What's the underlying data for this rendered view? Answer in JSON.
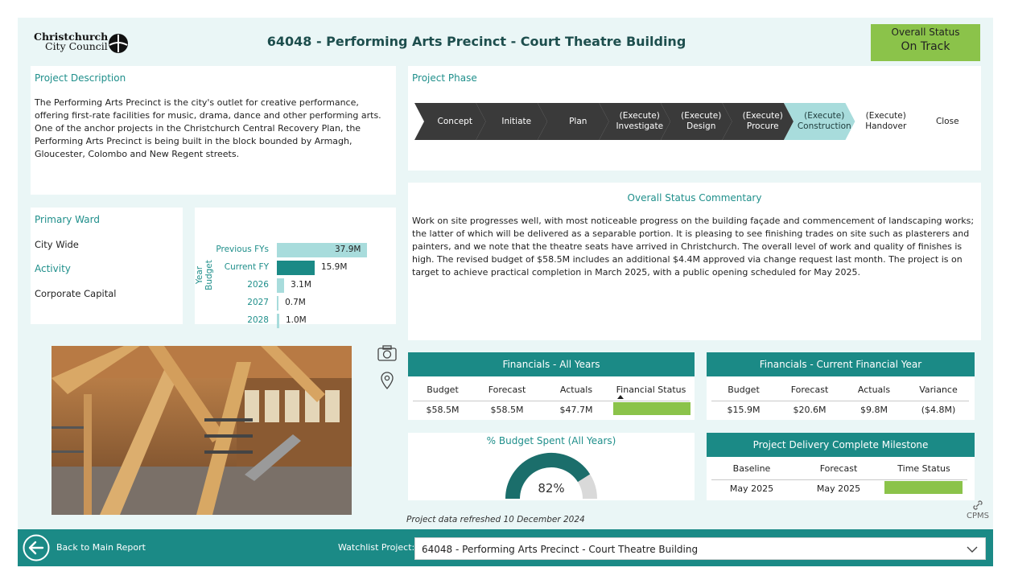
{
  "header": {
    "logo_line1": "Christchurch",
    "logo_line2": "City Council",
    "title": "64048 - Performing Arts Precinct - Court Theatre Building",
    "overall_status_label": "Overall Status",
    "overall_status_value": "On Track"
  },
  "description": {
    "title": "Project Description",
    "text": "The Performing Arts Precinct is the city's outlet for creative performance, offering first-rate facilities for music, drama, dance and other performing arts. One of the anchor projects in the Christchurch Central Recovery Plan, the Performing Arts Precinct is being built in the block bounded by Armagh, Gloucester, Colombo and New Regent streets."
  },
  "phase": {
    "title": "Project Phase",
    "steps": [
      {
        "line1": "",
        "line2": "Concept",
        "state": "done"
      },
      {
        "line1": "",
        "line2": "Initiate",
        "state": "done"
      },
      {
        "line1": "",
        "line2": "Plan",
        "state": "done"
      },
      {
        "line1": "(Execute)",
        "line2": "Investigate",
        "state": "done"
      },
      {
        "line1": "(Execute)",
        "line2": "Design",
        "state": "done"
      },
      {
        "line1": "(Execute)",
        "line2": "Procure",
        "state": "done"
      },
      {
        "line1": "(Execute)",
        "line2": "Construction",
        "state": "current"
      },
      {
        "line1": "(Execute)",
        "line2": "Handover",
        "state": "todo"
      },
      {
        "line1": "",
        "line2": "Close",
        "state": "todo"
      }
    ]
  },
  "commentary": {
    "title": "Overall Status Commentary",
    "text": "Work on site progresses well, with most noticeable progress on the building façade and commencement of landscaping works; the latter of which will be delivered as a separable portion. It is pleasing to see finishing trades on site such as plasterers and painters, and we note that the theatre seats have arrived in Christchurch. The overall level of work and quality of finishes is high. The revised budget of $58.5M includes an additional $4.4M approved via change request last month. The project is on target to achieve practical completion in March 2025, with a public opening scheduled for May 2025."
  },
  "ward": {
    "ward_label": "Primary Ward",
    "ward_value": "City Wide",
    "activity_label": "Activity",
    "activity_value": "Corporate Capital"
  },
  "chart_data": {
    "type": "bar",
    "orientation": "horizontal",
    "ylabel": "Year Budget",
    "categories": [
      "Previous FYs",
      "Current FY",
      "2026",
      "2027",
      "2028"
    ],
    "values": [
      37.9,
      15.9,
      3.1,
      0.7,
      1.0
    ],
    "value_labels": [
      "37.9M",
      "15.9M",
      "3.1M",
      "0.7M",
      "1.0M"
    ],
    "colors": [
      "#a8dcdc",
      "#1b8a86",
      "#a8dcdc",
      "#a8dcdc",
      "#a8dcdc"
    ],
    "xlim": [
      0,
      37.9
    ]
  },
  "icons": {
    "camera": "camera-icon",
    "location": "map-pin-icon",
    "link": "link-icon",
    "back": "back-arrow-icon",
    "chevron": "chevron-down-icon"
  },
  "fin_all": {
    "title": "Financials - All Years",
    "headers": [
      "Budget",
      "Forecast",
      "Actuals",
      "Financial Status"
    ],
    "values": [
      "$58.5M",
      "$58.5M",
      "$47.7M",
      ""
    ],
    "status_color": "#8bc34a"
  },
  "fin_current": {
    "title": "Financials - Current Financial Year",
    "headers": [
      "Budget",
      "Forecast",
      "Actuals",
      "Variance"
    ],
    "values": [
      "$15.9M",
      "$20.6M",
      "$9.8M",
      "($4.8M)"
    ]
  },
  "gauge": {
    "title": "% Budget Spent (All Years)",
    "value": 82,
    "label": "82%",
    "fill_color": "#1b6e6b",
    "track_color": "#d9d9d9"
  },
  "milestone": {
    "title": "Project Delivery Complete Milestone",
    "headers": [
      "Baseline",
      "Forecast",
      "Time Status"
    ],
    "values": [
      "May 2025",
      "May 2025",
      ""
    ],
    "status_color": "#8bc34a"
  },
  "refreshed": "Project data refreshed 10 December 2024",
  "cpms": "CPMS",
  "footer": {
    "back_label": "Back to Main Report",
    "watchlist_label": "Watchlist Project:",
    "watchlist_value": "64048 - Performing Arts Precinct - Court Theatre Building"
  },
  "colors": {
    "teal": "#1b8a86",
    "teal_light": "#a8dcdc",
    "dark": "#3a3a3a",
    "on_track": "#8bc34a"
  }
}
